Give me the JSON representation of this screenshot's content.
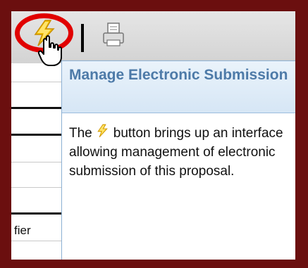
{
  "toolbar": {
    "lightning_icon": "lightning-bolt-icon",
    "print_icon": "printer-icon"
  },
  "background": {
    "cell_label": "fier"
  },
  "tooltip": {
    "title": "Manage Electronic Submission",
    "body_prefix": "The",
    "body_suffix": "button brings up an interface allowing management of electronic submission of this proposal."
  },
  "colors": {
    "frame": "#6b0f0f",
    "highlight_ring": "#e10000",
    "tooltip_title": "#4d7aa8",
    "bolt": "#f2c200"
  }
}
